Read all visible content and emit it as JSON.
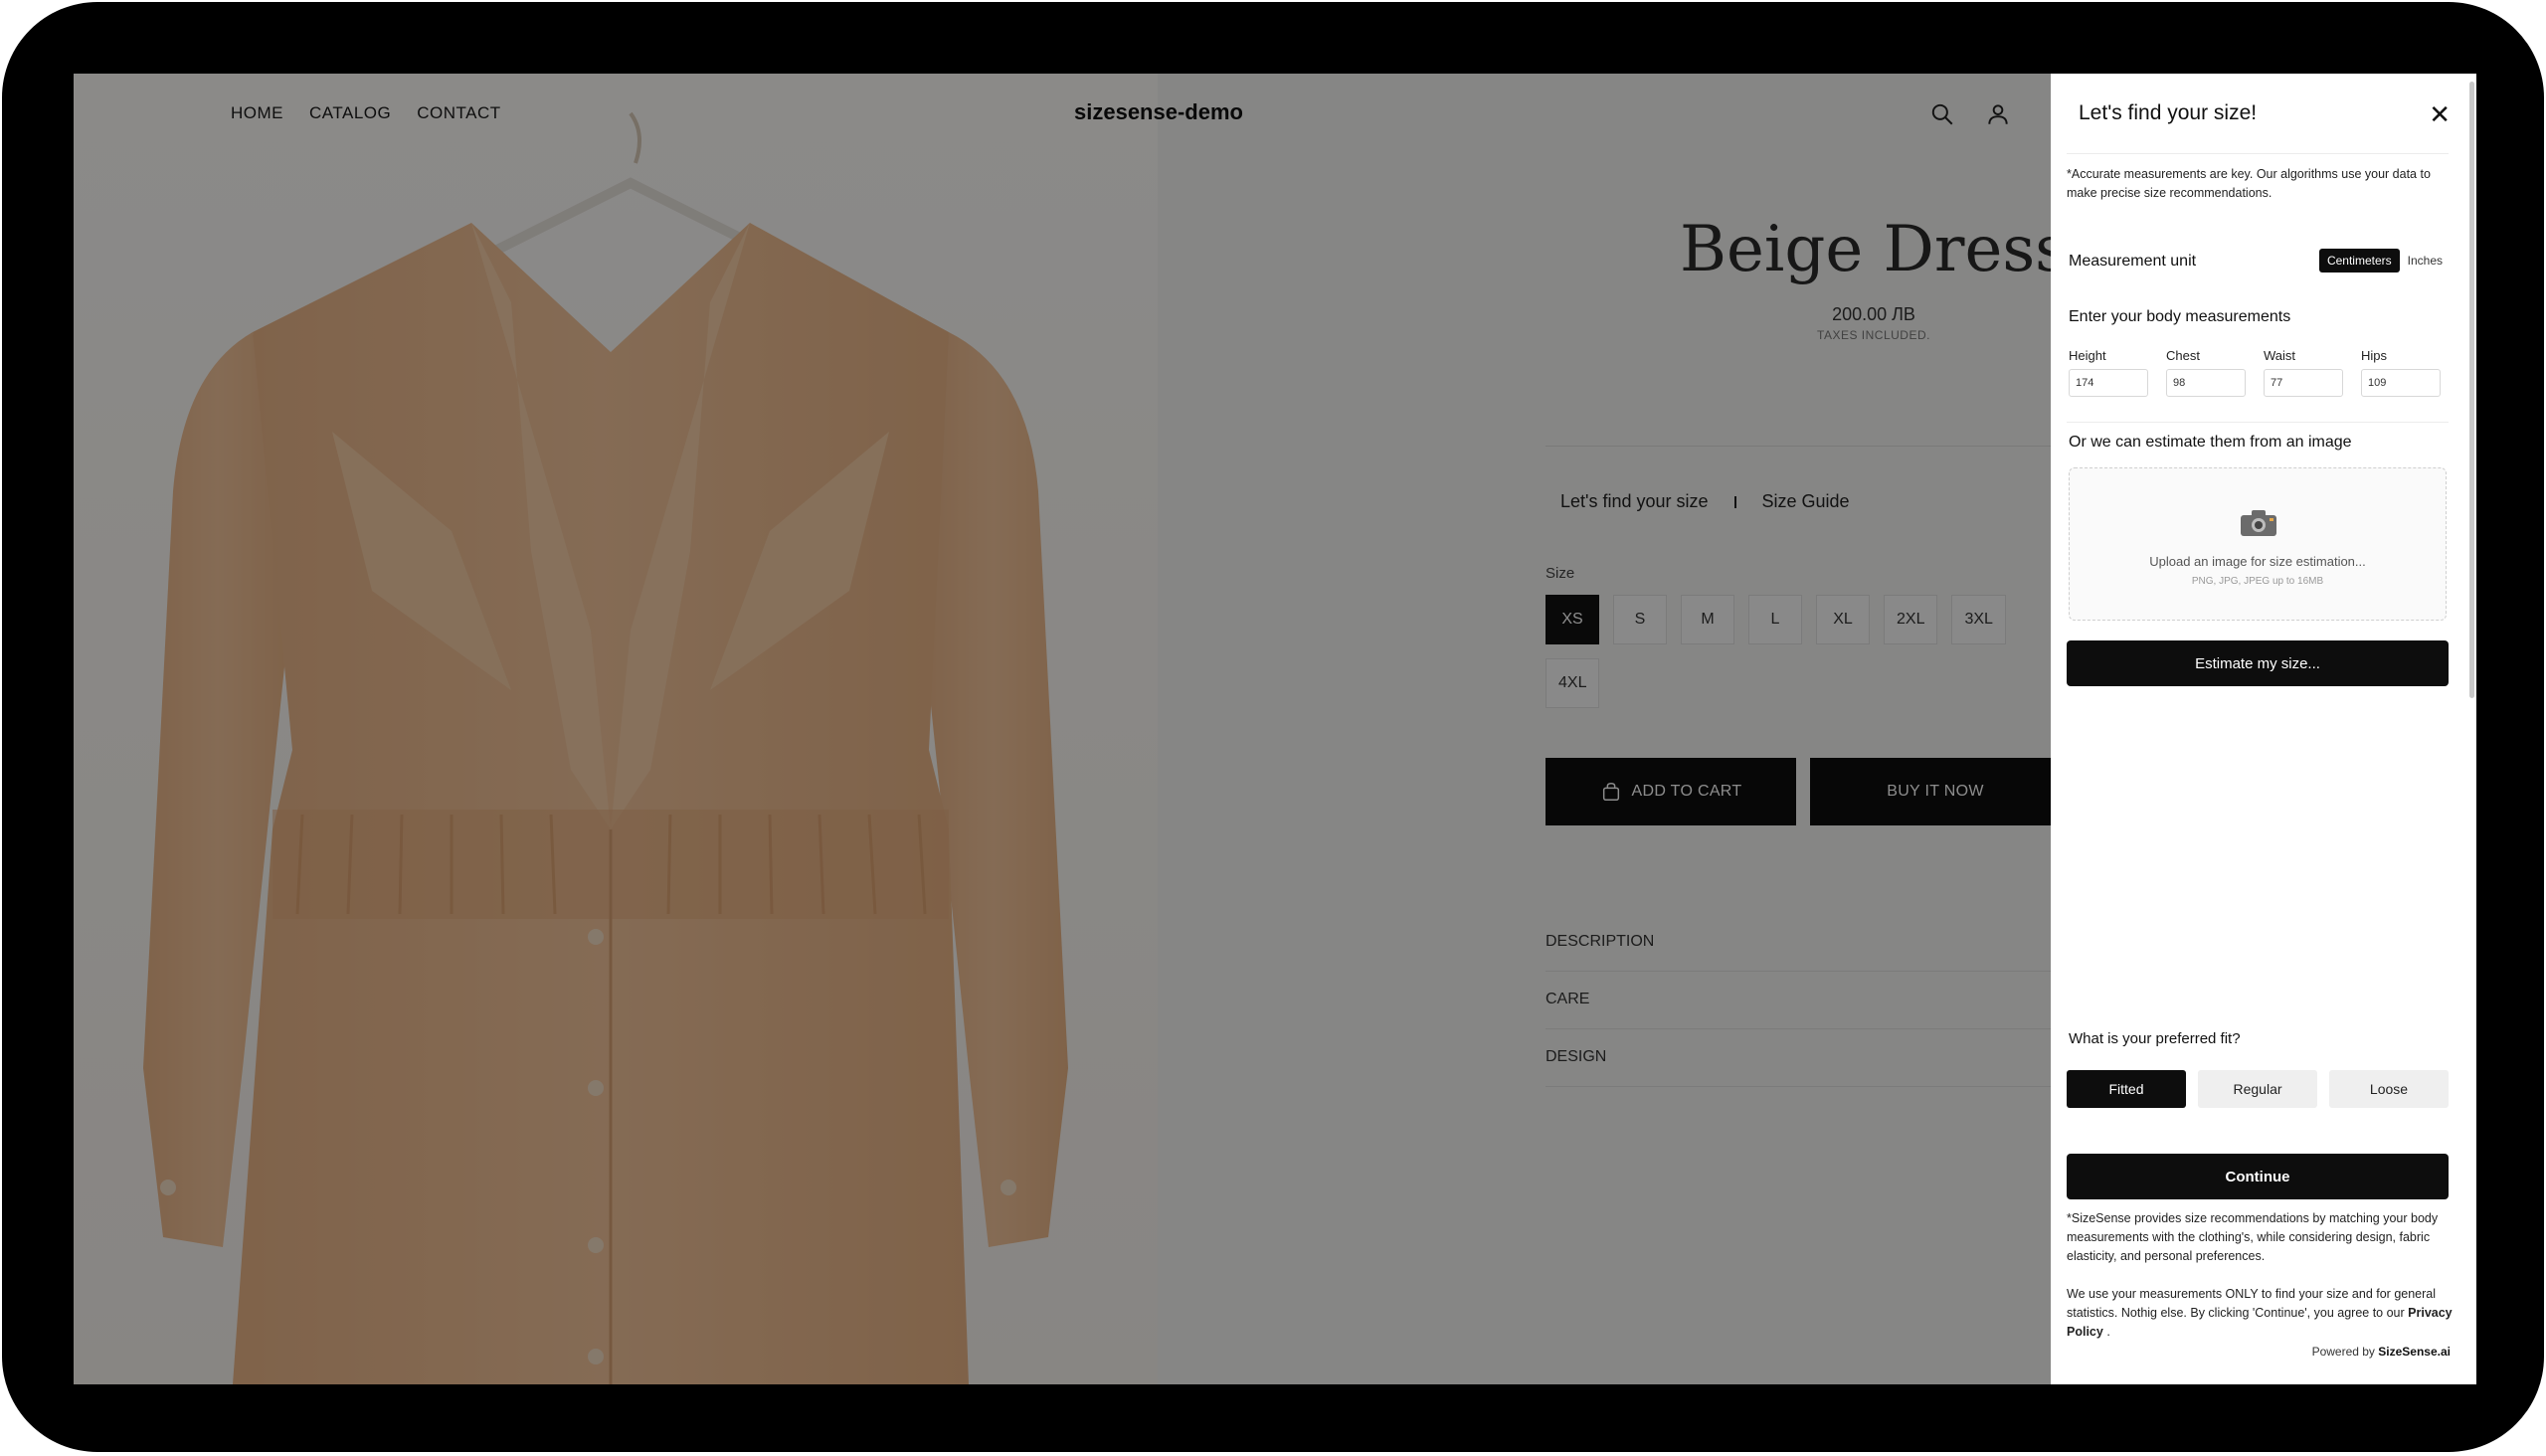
{
  "nav": {
    "links": [
      "HOME",
      "CATALOG",
      "CONTACT"
    ],
    "brand": "sizesense-demo",
    "icons": [
      "search-icon",
      "account-icon",
      "cart-icon"
    ]
  },
  "product": {
    "title": "Beige Dress",
    "price": "200.00 ЛВ",
    "taxes": "TAXES INCLUDED.",
    "find_size_link": "Let's find your size",
    "size_guide_link": "Size Guide",
    "size_label": "Size",
    "sizes": [
      "XS",
      "S",
      "M",
      "L",
      "XL",
      "2XL",
      "3XL",
      "4XL"
    ],
    "selected_size": "XS",
    "add_to_cart": "ADD TO CART",
    "buy_now": "BUY IT NOW",
    "accordions": [
      "DESCRIPTION",
      "CARE",
      "DESIGN"
    ]
  },
  "panel": {
    "title": "Let's find your size!",
    "close": "✕",
    "note": "*Accurate measurements are key. Our algorithms use your data to make precise size recommendations.",
    "unit_label": "Measurement unit",
    "units": [
      "Centimeters",
      "Inches"
    ],
    "selected_unit": "Centimeters",
    "body_title": "Enter your body measurements",
    "measurements": [
      {
        "label": "Height",
        "value": "174"
      },
      {
        "label": "Chest",
        "value": "98"
      },
      {
        "label": "Waist",
        "value": "77"
      },
      {
        "label": "Hips",
        "value": "109"
      }
    ],
    "image_title": "Or we can estimate them from an image",
    "upload_text": "Upload an image for size estimation...",
    "upload_sub": "PNG, JPG, JPEG up to 16MB",
    "estimate_button": "Estimate my size...",
    "fit_title": "What is your preferred fit?",
    "fits": [
      "Fitted",
      "Regular",
      "Loose"
    ],
    "selected_fit": "Fitted",
    "continue_button": "Continue",
    "legal_1": "*SizeSense provides size recommendations by matching your body measurements with the clothing's, while considering design, fabric elasticity, and personal preferences.",
    "legal_2": "We use your measurements ONLY to find your size and for general statistics. Nothig else. By clicking 'Continue', you agree to our",
    "privacy_link": "Privacy Policy",
    "legal_end": ".",
    "powered_prefix": "Powered by",
    "powered_brand": "SizeSense.ai"
  },
  "colors": {
    "primary": "#0d0d0d",
    "dress": "#f0bf94",
    "overlay": "rgba(0,0,0,0.45)"
  }
}
